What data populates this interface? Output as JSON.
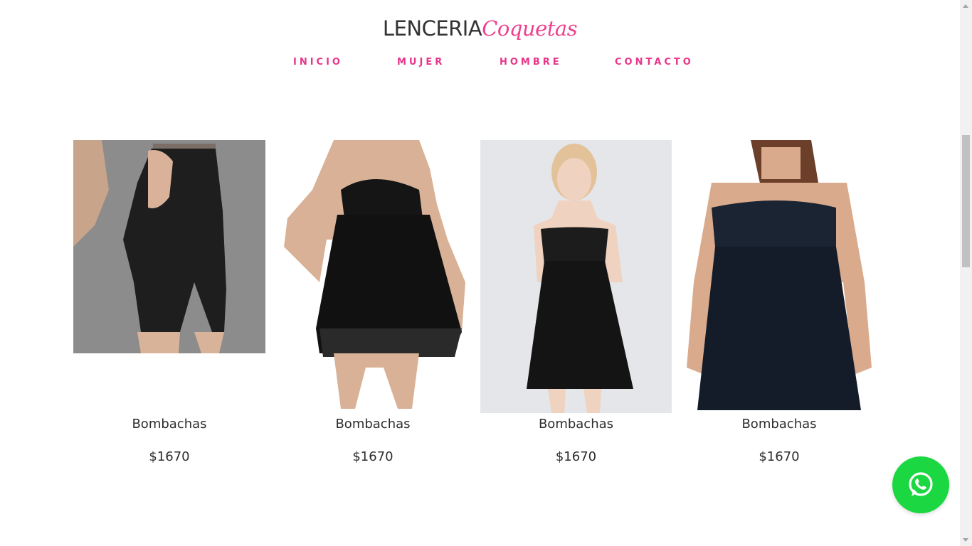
{
  "brand": {
    "main": "LENCERIA",
    "script": "Coquetas",
    "accent_color": "#ef3f8d"
  },
  "nav": {
    "items": [
      {
        "label": "INICIO"
      },
      {
        "label": "MUJER"
      },
      {
        "label": "HOMBRE"
      },
      {
        "label": "CONTACTO"
      }
    ],
    "color": "#e8358a"
  },
  "products": [
    {
      "title": "Bombachas",
      "price": "$1670",
      "image": "shaper-shorts-photo"
    },
    {
      "title": "Bombachas",
      "price": "$1670",
      "image": "lace-babydoll-photo"
    },
    {
      "title": "Bombachas",
      "price": "$1670",
      "image": "strappy-chemise-photo"
    },
    {
      "title": "Bombachas",
      "price": "$1670",
      "image": "plus-lace-babydoll-photo"
    }
  ],
  "whatsapp": {
    "icon": "whatsapp-icon",
    "color": "#1bd741"
  }
}
